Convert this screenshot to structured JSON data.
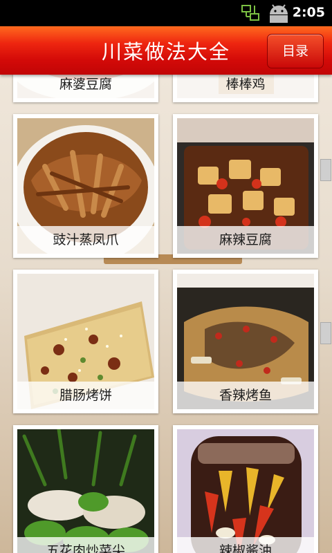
{
  "status_bar": {
    "time": "2:05"
  },
  "header": {
    "title": "川菜做法大全",
    "menu_label": "目录"
  },
  "recipes": [
    {
      "name": "麻婆豆腐"
    },
    {
      "name": "棒棒鸡"
    },
    {
      "name": "豉汁蒸凤爪"
    },
    {
      "name": "麻辣豆腐"
    },
    {
      "name": "腊肠烤饼"
    },
    {
      "name": "香辣烤鱼"
    },
    {
      "name": "五花肉炒菜尖"
    },
    {
      "name": "辣椒酱油"
    }
  ]
}
